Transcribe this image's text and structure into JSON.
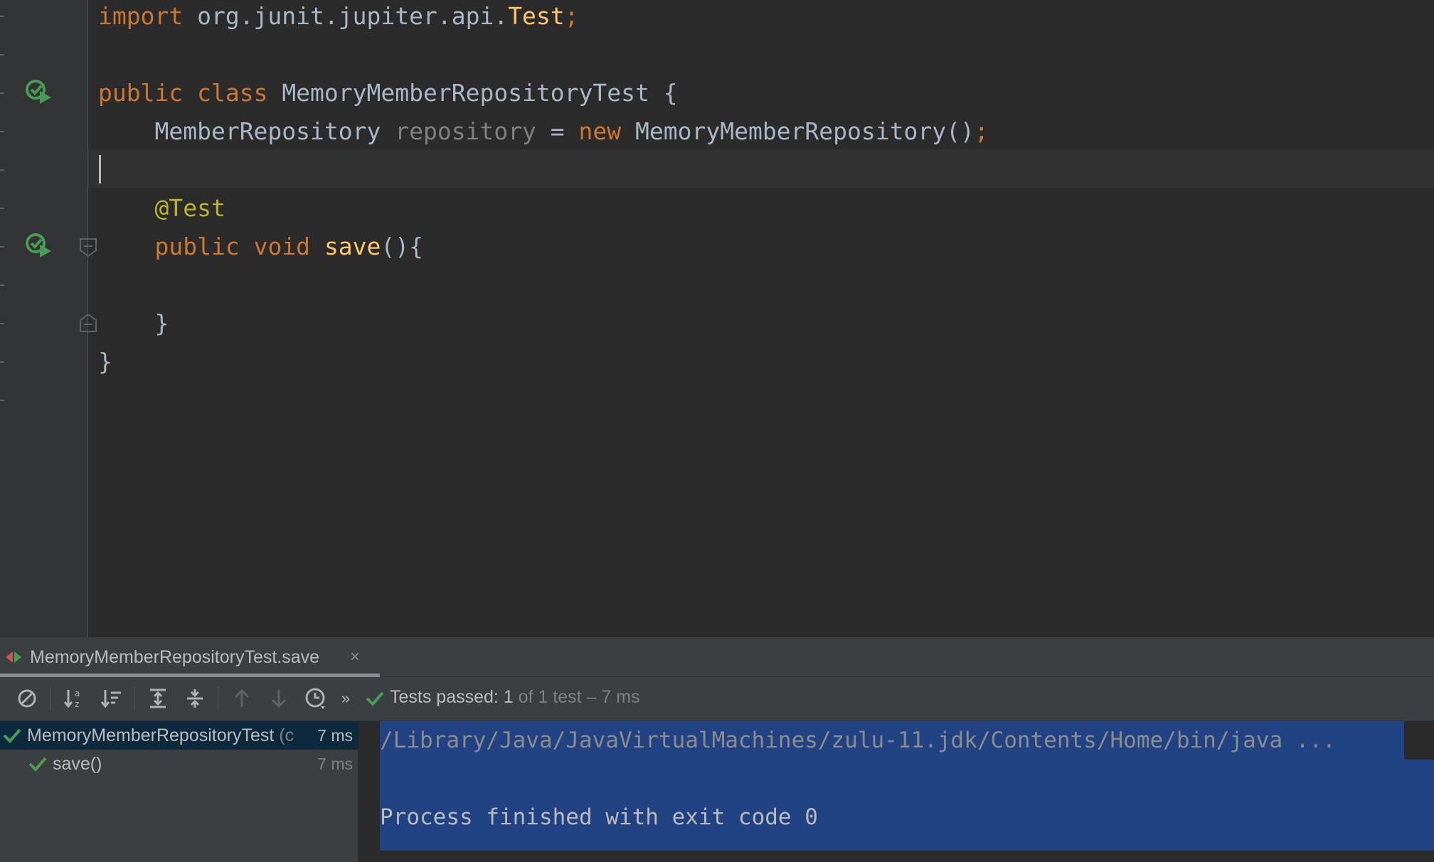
{
  "editor": {
    "lines": {
      "l0": {
        "kw": "import",
        "pkg": " org.junit.jupiter.api.",
        "cls": "Test",
        "semi": ";"
      },
      "l2": {
        "kw1": "public",
        "kw2": "class",
        "name": "MemoryMemberRepositoryTest",
        "brace": " {"
      },
      "l3": {
        "type": "MemberRepository",
        "field": "repository",
        "eq": " = ",
        "kw": "new",
        "ctor": " MemoryMemberRepository()",
        "semi": ";"
      },
      "l5": {
        "annotation": "@Test"
      },
      "l6": {
        "kw1": "public",
        "kw2": "void",
        "method": "save",
        "rest": "(){"
      },
      "l8": {
        "brace": "}"
      },
      "l9": {
        "brace": "}"
      }
    }
  },
  "run_window": {
    "tab_label": "MemoryMemberRepositoryTest.save",
    "tab_close": "×",
    "more": "»",
    "status": {
      "passed_label": "Tests passed: ",
      "passed_count": "1",
      "rest": " of 1 test – 7 ms"
    },
    "tree": [
      {
        "label": "MemoryMemberRepositoryTest",
        "suffix": " (c",
        "time": "7 ms"
      },
      {
        "label": "save()",
        "time": "7 ms"
      }
    ],
    "console": [
      "/Library/Java/JavaVirtualMachines/zulu-11.jdk/Contents/Home/bin/java ...",
      "",
      "Process finished with exit code 0"
    ]
  },
  "colors": {
    "background": "#2b2b2b",
    "keyword": "#cc7832",
    "type": "#ffc66d",
    "annotation": "#bbb529",
    "success_green": "#499c54",
    "selection": "#214283"
  }
}
